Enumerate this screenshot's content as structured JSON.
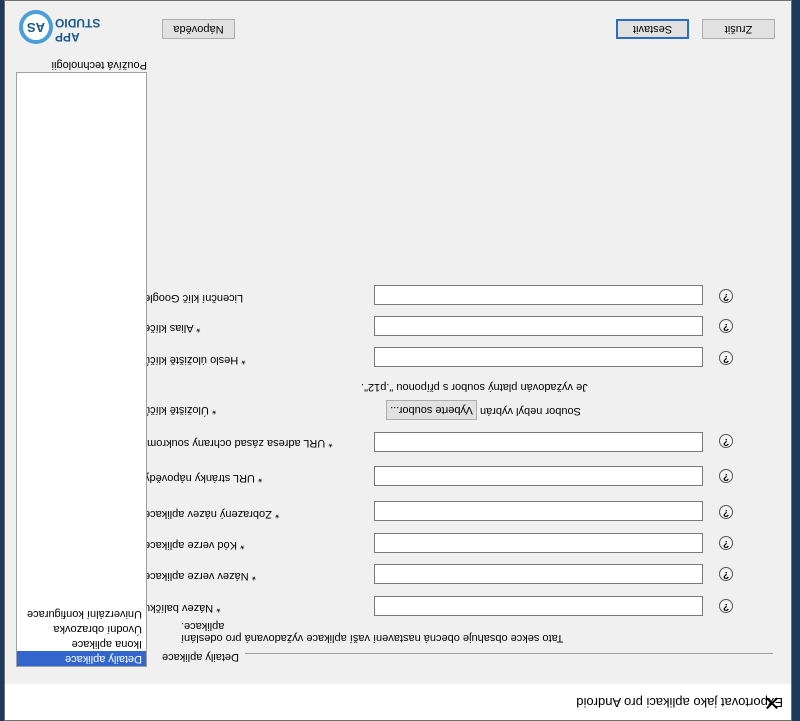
{
  "window": {
    "title": "Exportovat jako aplikaci pro Android",
    "close_glyph": "✕"
  },
  "logo": {
    "mark": "AS",
    "line1": "APP",
    "line2": "STUDIO"
  },
  "nav": {
    "label": "Používá technologii",
    "items": [
      {
        "label": "Detaily aplikace",
        "selected": true
      },
      {
        "label": "Ikona aplikace",
        "selected": false
      },
      {
        "label": "Úvodní obrazovka",
        "selected": false
      },
      {
        "label": "Univerzální konfigurace",
        "selected": false
      }
    ]
  },
  "section": {
    "header": "Detaily aplikace",
    "description": "Tato sekce obsahuje obecná nastavení vaší aplikace vyžadovaná pro odeslání aplikace."
  },
  "form": {
    "package_name": "* Název balíčku:",
    "version_name": "* Název verze aplikace:",
    "version_code": "* Kód verze aplikace:",
    "display_name": "* Zobrazený název aplikace:",
    "help_url": "* URL stránky nápovědy:",
    "privacy_url": "* URL adresa zásad ochrany soukromí:",
    "keystore": "* Úložiště klíčů:",
    "keystore_button": "Vyberte soubor...",
    "keystore_status": "Soubor nebyl vybrán",
    "keystore_hint": "Je vyžadován platný soubor s příponou \".p12\".",
    "keystore_password": "* Heslo úložiště klíčů:",
    "key_alias": "* Alias klíče:",
    "license_key": "Licenční klíč Google:",
    "help_glyph": "?"
  },
  "buttons": {
    "help": "Nápověda",
    "create": "Sestavit",
    "cancel": "Zrušit"
  },
  "colors": {
    "selection": "#3366cc",
    "accent": "#2a6ebd",
    "logo": "#4a9fd8"
  }
}
